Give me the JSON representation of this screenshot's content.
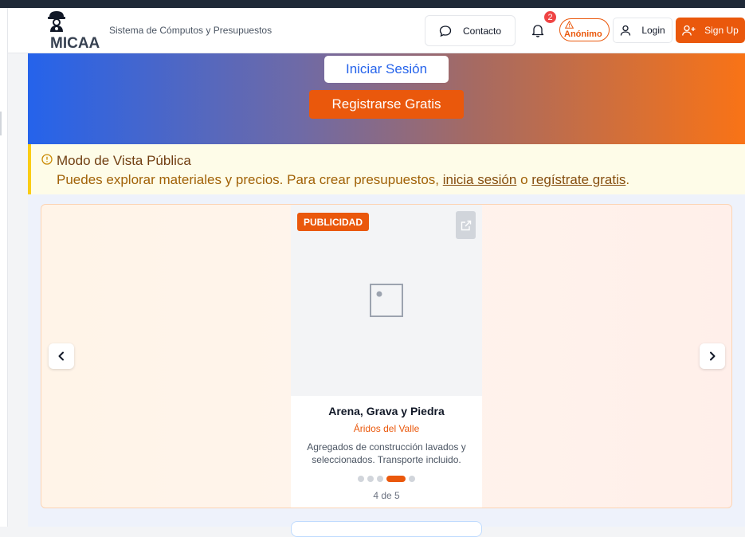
{
  "header": {
    "logo_text": "MICAA",
    "subtitle": "Sistema de Cómputos y Presupuestos",
    "contact_label": "Contacto",
    "notification_count": "2",
    "anon_label": "Anónimo",
    "login_label": "Login",
    "signup_label": "Sign Up"
  },
  "hero": {
    "login_button": "Iniciar Sesión",
    "register_button": "Registrarse Gratis"
  },
  "notice": {
    "title": "Modo de Vista Pública",
    "text_before": "Puedes explorar materiales y precios. Para crear presupuestos, ",
    "login_link": "inicia sesión",
    "text_middle": " o ",
    "register_link": "regístrate gratis",
    "text_after": "."
  },
  "carousel": {
    "badge": "PUBLICIDAD",
    "title": "Arena, Grava y Piedra",
    "company": "Áridos del Valle",
    "description": "Agregados de construcción lavados y seleccionados. Transporte incluido.",
    "total_slides": 5,
    "active_slide": 4,
    "page_indicator": "4 de 5"
  },
  "colors": {
    "accent": "#ea580c",
    "primary": "#2563eb",
    "notice_border": "#facc15"
  }
}
